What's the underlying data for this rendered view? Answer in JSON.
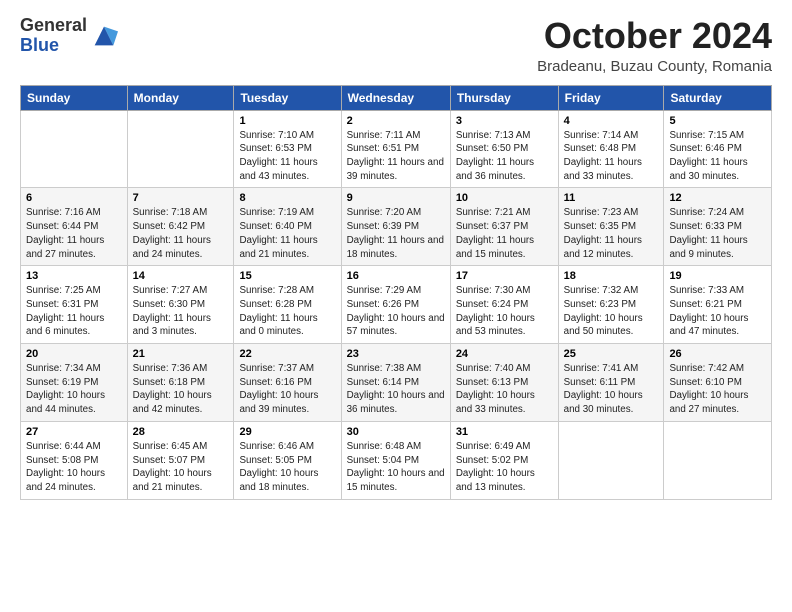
{
  "header": {
    "logo_line1": "General",
    "logo_line2": "Blue",
    "month_title": "October 2024",
    "location": "Bradeanu, Buzau County, Romania"
  },
  "days_of_week": [
    "Sunday",
    "Monday",
    "Tuesday",
    "Wednesday",
    "Thursday",
    "Friday",
    "Saturday"
  ],
  "weeks": [
    [
      {
        "day": "",
        "info": ""
      },
      {
        "day": "",
        "info": ""
      },
      {
        "day": "1",
        "info": "Sunrise: 7:10 AM\nSunset: 6:53 PM\nDaylight: 11 hours and 43 minutes."
      },
      {
        "day": "2",
        "info": "Sunrise: 7:11 AM\nSunset: 6:51 PM\nDaylight: 11 hours and 39 minutes."
      },
      {
        "day": "3",
        "info": "Sunrise: 7:13 AM\nSunset: 6:50 PM\nDaylight: 11 hours and 36 minutes."
      },
      {
        "day": "4",
        "info": "Sunrise: 7:14 AM\nSunset: 6:48 PM\nDaylight: 11 hours and 33 minutes."
      },
      {
        "day": "5",
        "info": "Sunrise: 7:15 AM\nSunset: 6:46 PM\nDaylight: 11 hours and 30 minutes."
      }
    ],
    [
      {
        "day": "6",
        "info": "Sunrise: 7:16 AM\nSunset: 6:44 PM\nDaylight: 11 hours and 27 minutes."
      },
      {
        "day": "7",
        "info": "Sunrise: 7:18 AM\nSunset: 6:42 PM\nDaylight: 11 hours and 24 minutes."
      },
      {
        "day": "8",
        "info": "Sunrise: 7:19 AM\nSunset: 6:40 PM\nDaylight: 11 hours and 21 minutes."
      },
      {
        "day": "9",
        "info": "Sunrise: 7:20 AM\nSunset: 6:39 PM\nDaylight: 11 hours and 18 minutes."
      },
      {
        "day": "10",
        "info": "Sunrise: 7:21 AM\nSunset: 6:37 PM\nDaylight: 11 hours and 15 minutes."
      },
      {
        "day": "11",
        "info": "Sunrise: 7:23 AM\nSunset: 6:35 PM\nDaylight: 11 hours and 12 minutes."
      },
      {
        "day": "12",
        "info": "Sunrise: 7:24 AM\nSunset: 6:33 PM\nDaylight: 11 hours and 9 minutes."
      }
    ],
    [
      {
        "day": "13",
        "info": "Sunrise: 7:25 AM\nSunset: 6:31 PM\nDaylight: 11 hours and 6 minutes."
      },
      {
        "day": "14",
        "info": "Sunrise: 7:27 AM\nSunset: 6:30 PM\nDaylight: 11 hours and 3 minutes."
      },
      {
        "day": "15",
        "info": "Sunrise: 7:28 AM\nSunset: 6:28 PM\nDaylight: 11 hours and 0 minutes."
      },
      {
        "day": "16",
        "info": "Sunrise: 7:29 AM\nSunset: 6:26 PM\nDaylight: 10 hours and 57 minutes."
      },
      {
        "day": "17",
        "info": "Sunrise: 7:30 AM\nSunset: 6:24 PM\nDaylight: 10 hours and 53 minutes."
      },
      {
        "day": "18",
        "info": "Sunrise: 7:32 AM\nSunset: 6:23 PM\nDaylight: 10 hours and 50 minutes."
      },
      {
        "day": "19",
        "info": "Sunrise: 7:33 AM\nSunset: 6:21 PM\nDaylight: 10 hours and 47 minutes."
      }
    ],
    [
      {
        "day": "20",
        "info": "Sunrise: 7:34 AM\nSunset: 6:19 PM\nDaylight: 10 hours and 44 minutes."
      },
      {
        "day": "21",
        "info": "Sunrise: 7:36 AM\nSunset: 6:18 PM\nDaylight: 10 hours and 42 minutes."
      },
      {
        "day": "22",
        "info": "Sunrise: 7:37 AM\nSunset: 6:16 PM\nDaylight: 10 hours and 39 minutes."
      },
      {
        "day": "23",
        "info": "Sunrise: 7:38 AM\nSunset: 6:14 PM\nDaylight: 10 hours and 36 minutes."
      },
      {
        "day": "24",
        "info": "Sunrise: 7:40 AM\nSunset: 6:13 PM\nDaylight: 10 hours and 33 minutes."
      },
      {
        "day": "25",
        "info": "Sunrise: 7:41 AM\nSunset: 6:11 PM\nDaylight: 10 hours and 30 minutes."
      },
      {
        "day": "26",
        "info": "Sunrise: 7:42 AM\nSunset: 6:10 PM\nDaylight: 10 hours and 27 minutes."
      }
    ],
    [
      {
        "day": "27",
        "info": "Sunrise: 6:44 AM\nSunset: 5:08 PM\nDaylight: 10 hours and 24 minutes."
      },
      {
        "day": "28",
        "info": "Sunrise: 6:45 AM\nSunset: 5:07 PM\nDaylight: 10 hours and 21 minutes."
      },
      {
        "day": "29",
        "info": "Sunrise: 6:46 AM\nSunset: 5:05 PM\nDaylight: 10 hours and 18 minutes."
      },
      {
        "day": "30",
        "info": "Sunrise: 6:48 AM\nSunset: 5:04 PM\nDaylight: 10 hours and 15 minutes."
      },
      {
        "day": "31",
        "info": "Sunrise: 6:49 AM\nSunset: 5:02 PM\nDaylight: 10 hours and 13 minutes."
      },
      {
        "day": "",
        "info": ""
      },
      {
        "day": "",
        "info": ""
      }
    ]
  ]
}
